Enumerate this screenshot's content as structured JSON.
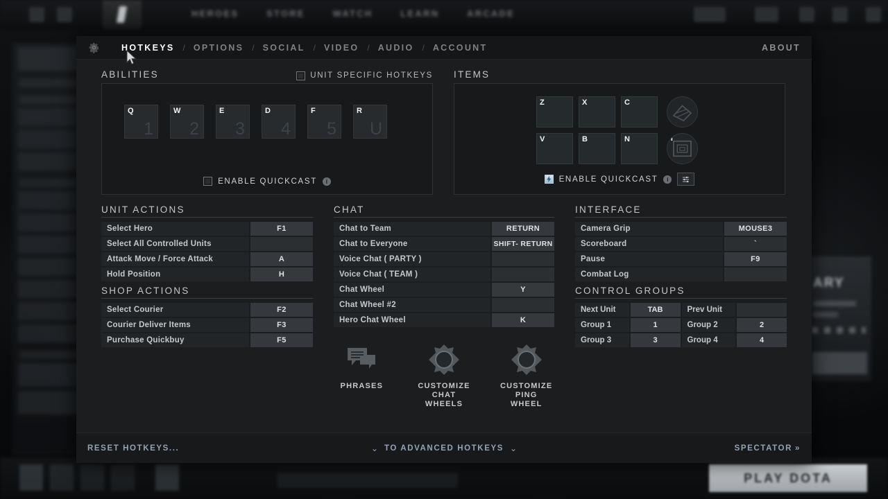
{
  "background": {
    "nav_items": [
      "HEROES",
      "STORE",
      "WATCH",
      "LEARN",
      "ARCADE"
    ],
    "play_button": "PLAY DOTA",
    "right_panel_title": "ARY"
  },
  "dialog": {
    "gear_icon": "gear-icon",
    "tabs": [
      {
        "label": "HOTKEYS",
        "active": true
      },
      {
        "label": "OPTIONS",
        "active": false
      },
      {
        "label": "SOCIAL",
        "active": false
      },
      {
        "label": "VIDEO",
        "active": false
      },
      {
        "label": "AUDIO",
        "active": false
      },
      {
        "label": "ACCOUNT",
        "active": false
      }
    ],
    "tab_separator": "/",
    "about_label": "ABOUT"
  },
  "abilities": {
    "title": "ABILITIES",
    "unit_specific_hotkeys": {
      "label": "UNIT SPECIFIC HOTKEYS",
      "checked": false
    },
    "keys": [
      {
        "letter": "Q",
        "ghost": "1"
      },
      {
        "letter": "W",
        "ghost": "2"
      },
      {
        "letter": "E",
        "ghost": "3"
      },
      {
        "letter": "D",
        "ghost": "4"
      },
      {
        "letter": "F",
        "ghost": "5"
      },
      {
        "letter": "R",
        "ghost": "U"
      }
    ],
    "quickcast": {
      "label": "ENABLE QUICKCAST",
      "checked": false,
      "info": "i"
    }
  },
  "items": {
    "title": "ITEMS",
    "row1": [
      {
        "letter": "Z"
      },
      {
        "letter": "X"
      },
      {
        "letter": "C"
      }
    ],
    "row2": [
      {
        "letter": "V"
      },
      {
        "letter": "B"
      },
      {
        "letter": "N"
      }
    ],
    "circle1": {
      "letter": "",
      "icon": "item-neutral-icon"
    },
    "circle2": {
      "letter": "T",
      "icon": "tp-scroll-icon"
    },
    "quickcast": {
      "label": "ENABLE QUICKCAST",
      "checked": true,
      "info": "i"
    },
    "settings_button": "sliders-icon"
  },
  "unit_actions": {
    "title": "UNIT ACTIONS",
    "rows": [
      {
        "label": "Select Hero",
        "key": "F1"
      },
      {
        "label": "Select All Controlled Units",
        "key": ""
      },
      {
        "label": "Attack Move / Force Attack",
        "key": "A"
      },
      {
        "label": "Hold Position",
        "key": "H"
      }
    ]
  },
  "shop_actions": {
    "title": "SHOP ACTIONS",
    "rows": [
      {
        "label": "Select Courier",
        "key": "F2"
      },
      {
        "label": "Courier Deliver Items",
        "key": "F3"
      },
      {
        "label": "Purchase Quickbuy",
        "key": "F5"
      }
    ]
  },
  "chat": {
    "title": "CHAT",
    "rows": [
      {
        "label": "Chat to Team",
        "key": "RETURN"
      },
      {
        "label": "Chat to Everyone",
        "key": "SHIFT- RETURN"
      },
      {
        "label": "Voice Chat ( PARTY )",
        "key": ""
      },
      {
        "label": "Voice Chat ( TEAM )",
        "key": ""
      },
      {
        "label": "Chat Wheel",
        "key": "Y"
      },
      {
        "label": "Chat Wheel #2",
        "key": ""
      },
      {
        "label": "Hero Chat Wheel",
        "key": "K"
      }
    ],
    "icons": [
      {
        "label": "PHRASES",
        "icon": "chat-bubbles-icon"
      },
      {
        "label": "CUSTOMIZE\nCHAT WHEELS",
        "icon": "chat-wheel-icon"
      },
      {
        "label": "CUSTOMIZE\nPING WHEEL",
        "icon": "ping-wheel-icon"
      }
    ]
  },
  "interface": {
    "title": "INTERFACE",
    "rows": [
      {
        "label": "Camera Grip",
        "key": "MOUSE3"
      },
      {
        "label": "Scoreboard",
        "key": "`"
      },
      {
        "label": "Pause",
        "key": "F9"
      },
      {
        "label": "Combat Log",
        "key": ""
      }
    ]
  },
  "control_groups": {
    "title": "CONTROL GROUPS",
    "rows": [
      {
        "label_a": "Next Unit",
        "key_a": "TAB",
        "label_b": "Prev Unit",
        "key_b": ""
      },
      {
        "label_a": "Group 1",
        "key_a": "1",
        "label_b": "Group 2",
        "key_b": "2"
      },
      {
        "label_a": "Group 3",
        "key_a": "3",
        "label_b": "Group 4",
        "key_b": "4"
      }
    ]
  },
  "footer": {
    "reset": "RESET HOTKEYS...",
    "advanced": "TO ADVANCED HOTKEYS",
    "chevron_left": "⌄",
    "chevron_right": "⌄",
    "spectator": "SPECTATOR",
    "spectator_arrow": "»"
  }
}
